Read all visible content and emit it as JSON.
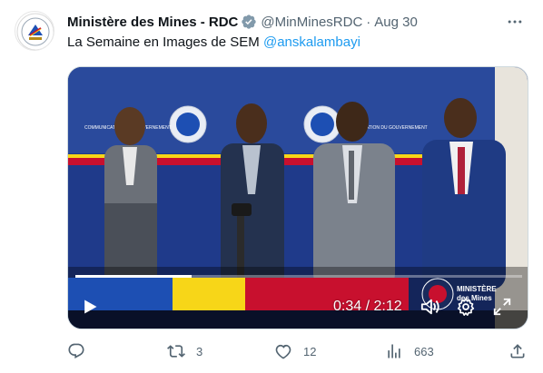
{
  "tweet": {
    "author": {
      "name": "Ministère des Mines - RDC",
      "handle": "@MinMinesRDC",
      "separator": "·",
      "time": "Aug 30",
      "verified": true,
      "verified_color": "#829aab"
    },
    "text": {
      "body": "La Semaine en Images de SEM",
      "mention": "@anskalambayi"
    },
    "video": {
      "current_time": "0:34",
      "duration": "2:12",
      "time_display": "0:34 / 2:12",
      "progress_fraction": 0.26,
      "watermark_line1": "MINISTÈRE",
      "watermark_line2": "des Mines",
      "backdrop_text_left": "COMMUNICATION DU GOUVERNEMENT",
      "backdrop_text_right": "COMMUNICATION DU GOUVERNEMENT"
    },
    "actions": {
      "replies": "",
      "retweets": "3",
      "likes": "12",
      "views": "663"
    },
    "colors": {
      "accent": "#1d9bf0",
      "muted": "#536471",
      "text": "#0f1419",
      "backdrop_blue": "#1f3a8a",
      "flag_red": "#c8102e",
      "flag_yellow": "#f7d618"
    },
    "icons": {
      "more": "more-dots-icon",
      "play": "play-icon",
      "volume": "volume-icon",
      "settings": "gear-icon",
      "fullscreen": "fullscreen-icon",
      "reply": "reply-icon",
      "retweet": "retweet-icon",
      "like": "heart-icon",
      "views": "analytics-icon",
      "share": "share-icon"
    }
  }
}
